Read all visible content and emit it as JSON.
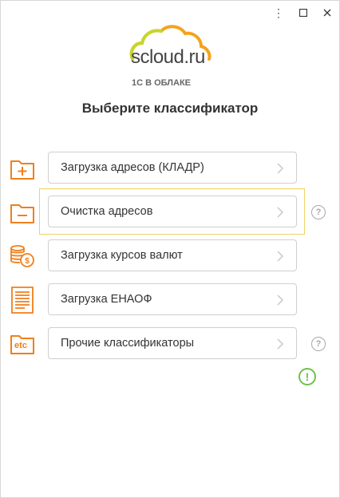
{
  "window": {
    "controls": {
      "menu": "⋮",
      "minimize": "□",
      "close": "✕"
    }
  },
  "logo": {
    "brand": "scloud.ru",
    "sub": "1С В ОБЛАКЕ"
  },
  "title": "Выберите классификатор",
  "items": [
    {
      "label": "Загрузка адресов (КЛАДР)",
      "icon": "folder-plus-icon",
      "help": false
    },
    {
      "label": "Очистка адресов",
      "icon": "folder-minus-icon",
      "help": true
    },
    {
      "label": "Загрузка курсов валют",
      "icon": "coins-icon",
      "help": false
    },
    {
      "label": "Загрузка ЕНАОФ",
      "icon": "document-icon",
      "help": false
    },
    {
      "label": "Прочие классификаторы",
      "icon": "folder-etc-icon",
      "help": true,
      "etc_text": "etc"
    }
  ],
  "help_glyph": "?",
  "alert_glyph": "!",
  "colors": {
    "accent": "#f07f1a",
    "highlight": "#f0d264",
    "success": "#6cc24a"
  }
}
